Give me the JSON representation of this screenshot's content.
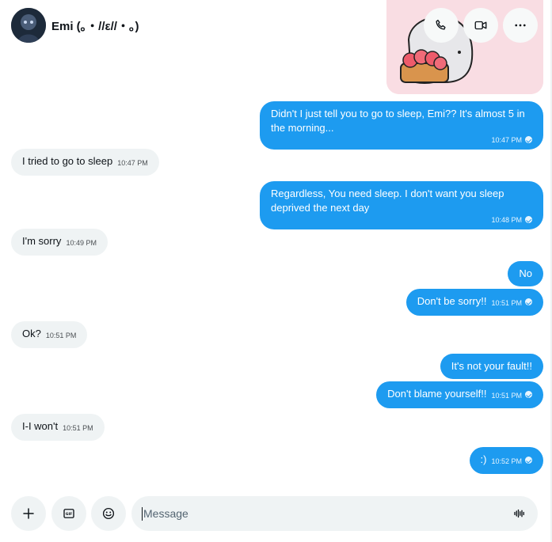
{
  "conversation": {
    "contact_name": "Emi (｡・//ε//・｡)"
  },
  "header": {
    "call_icon": "phone-icon",
    "video_icon": "video-icon",
    "more_icon": "more-icon"
  },
  "messages": [
    {
      "side": "sent",
      "text": "Didn't I just tell you to go to sleep, Emi?? It's almost 5 in the morning...",
      "time": "10:47 PM"
    },
    {
      "side": "received",
      "text": "I tried to go to sleep",
      "time": "10:47 PM"
    },
    {
      "side": "sent",
      "text": "Regardless, You need sleep. I don't want you sleep deprived the next day",
      "time": "10:48 PM"
    },
    {
      "side": "received",
      "text": "I'm sorry",
      "time": "10:49 PM"
    },
    {
      "side": "sent",
      "text": "No",
      "time": ""
    },
    {
      "side": "sent",
      "text": "Don't be sorry!!",
      "time": "10:51 PM"
    },
    {
      "side": "received",
      "text": "Ok?",
      "time": "10:51 PM"
    },
    {
      "side": "sent",
      "text": "It's not your fault!!",
      "time": ""
    },
    {
      "side": "sent",
      "text": "Don't blame yourself!!",
      "time": "10:51 PM"
    },
    {
      "side": "received",
      "text": "I-I won't",
      "time": "10:51 PM"
    },
    {
      "side": "sent",
      "text": ":)",
      "time": "10:52 PM"
    }
  ],
  "composer": {
    "placeholder": "Message",
    "value": "",
    "add_icon": "plus-icon",
    "gif_icon": "gif-icon",
    "emoji_icon": "emoji-icon",
    "voice_icon": "voice-waveform-icon"
  },
  "colors": {
    "sent_bubble": "#1d9bf0",
    "received_bubble": "#eff3f4",
    "text": "#0f1419"
  }
}
